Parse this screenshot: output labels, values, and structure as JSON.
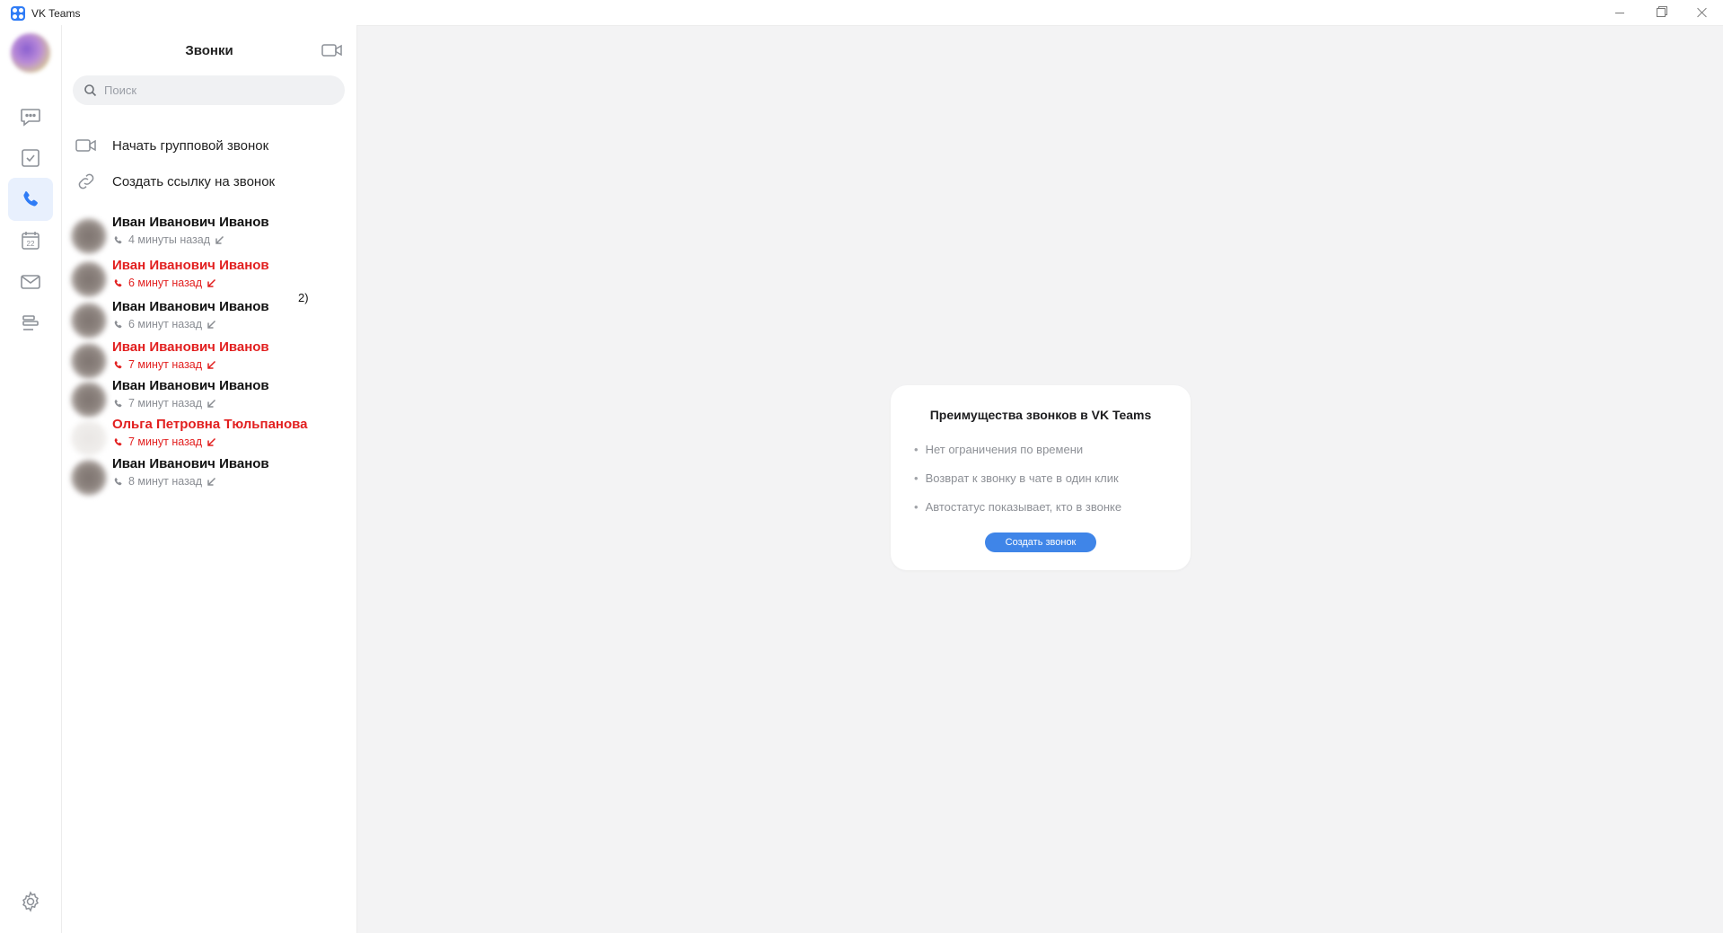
{
  "window": {
    "title": "VK Teams"
  },
  "rail": {
    "items": [
      {
        "icon": "chat-icon"
      },
      {
        "icon": "tasks-icon"
      },
      {
        "icon": "phone-icon",
        "active": true
      },
      {
        "icon": "calendar-icon",
        "label": "22"
      },
      {
        "icon": "mail-icon"
      },
      {
        "icon": "bar-list-icon"
      }
    ]
  },
  "calls_panel": {
    "title": "Звонки",
    "search_placeholder": "Поиск",
    "actions": {
      "group_call": "Начать групповой звонок",
      "create_link": "Создать ссылку на звонок"
    },
    "side_note": "2)",
    "history": [
      {
        "name": "Иван Иванович Иванов",
        "time": "4 минуты назад",
        "missed": false
      },
      {
        "name": "Иван Иванович Иванов",
        "time": "6 минут назад",
        "missed": true
      },
      {
        "name": "Иван Иванович Иванов",
        "time": "6 минут назад",
        "missed": false
      },
      {
        "name": "Иван Иванович Иванов",
        "time": "7 минут назад",
        "missed": true
      },
      {
        "name": "Иван Иванович Иванов",
        "time": "7 минут назад",
        "missed": false
      },
      {
        "name": "Ольга Петровна Тюльпанова",
        "time": "7 минут назад",
        "missed": true
      },
      {
        "name": "Иван Иванович Иванов",
        "time": "8 минут назад",
        "missed": false
      }
    ]
  },
  "promo": {
    "title": "Преимущества звонков в VK Teams",
    "bullets": [
      "Нет ограничения по времени",
      "Возврат к звонку в чате в один клик",
      "Автостатус показывает, кто в звонке"
    ],
    "button": "Создать звонок"
  },
  "colors": {
    "accent": "#3f85e8",
    "missed": "#e21f1f",
    "muted": "#8a8d93"
  }
}
